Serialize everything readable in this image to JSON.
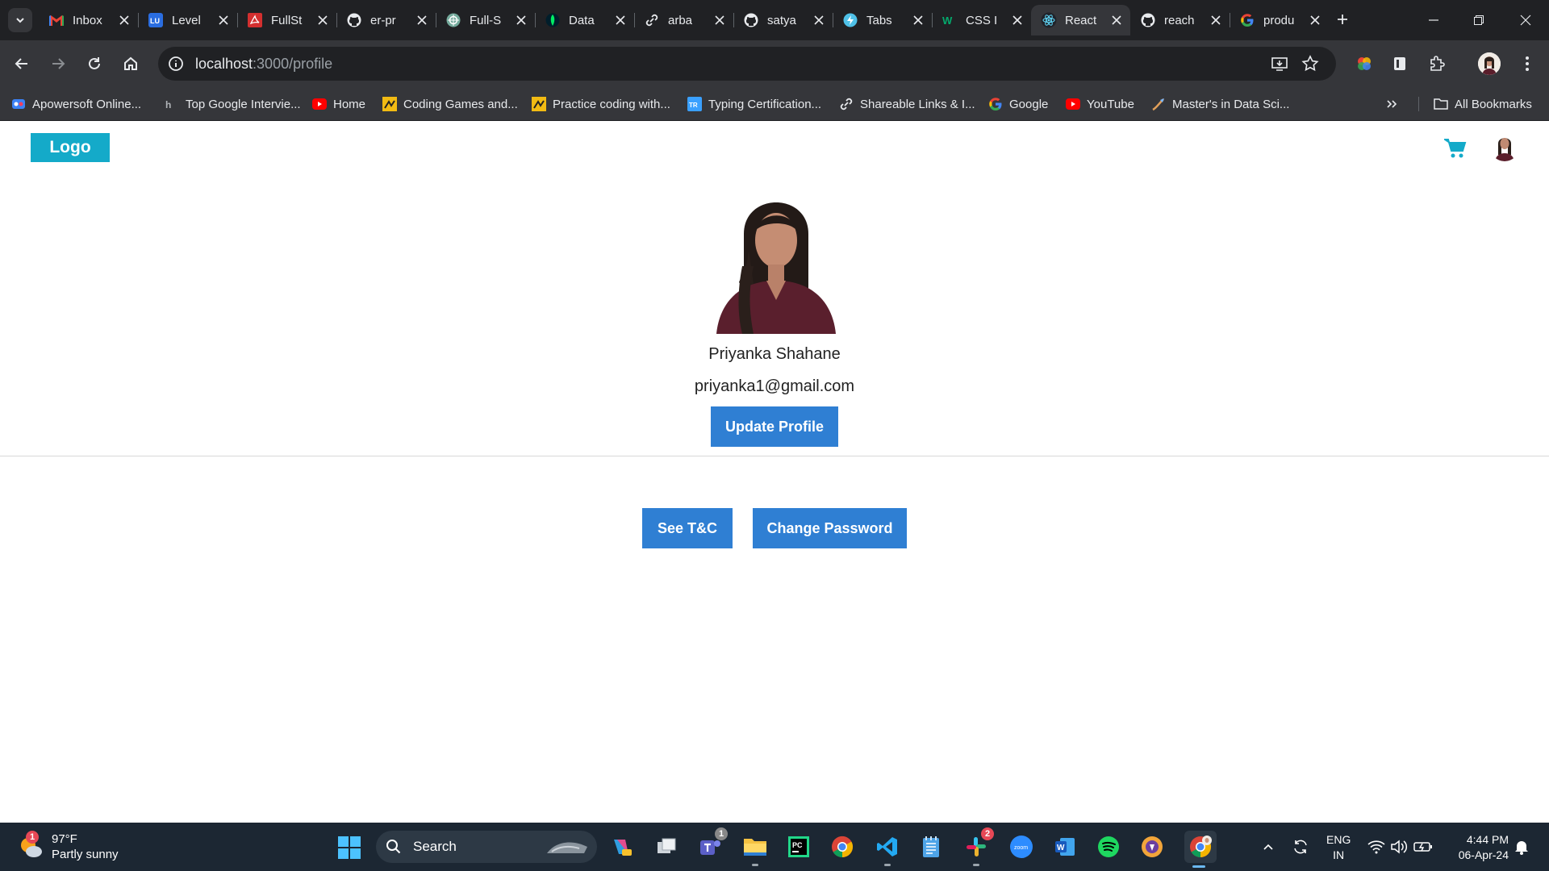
{
  "browser": {
    "tabs": [
      {
        "title": "Inbox",
        "icon": "gmail-icon",
        "active": false
      },
      {
        "title": "Level",
        "icon": "lu-icon",
        "active": false
      },
      {
        "title": "FullSt",
        "icon": "pdf-icon",
        "active": false
      },
      {
        "title": "er-pr",
        "icon": "github-icon",
        "active": false
      },
      {
        "title": "Full-S",
        "icon": "chatgpt-icon",
        "active": false
      },
      {
        "title": "Data",
        "icon": "mongodb-icon",
        "active": false
      },
      {
        "title": "arba",
        "icon": "link-icon",
        "active": false
      },
      {
        "title": "satya",
        "icon": "github-icon",
        "active": false
      },
      {
        "title": "Tabs",
        "icon": "bolt-icon",
        "active": false
      },
      {
        "title": "CSS I",
        "icon": "w3-icon",
        "active": false
      },
      {
        "title": "React",
        "icon": "react-icon",
        "active": true
      },
      {
        "title": "reach",
        "icon": "github-icon",
        "active": false
      },
      {
        "title": "produ",
        "icon": "google-icon",
        "active": false
      }
    ],
    "url_host": "localhost",
    "url_path": ":3000/profile",
    "bookmarks": [
      {
        "label": "Apowersoft Online...",
        "icon": "apowersoft-icon"
      },
      {
        "label": "Top Google Intervie...",
        "icon": "page-icon"
      },
      {
        "label": "Home",
        "icon": "youtube-icon"
      },
      {
        "label": "Coding Games and...",
        "icon": "codingame-icon"
      },
      {
        "label": "Practice coding with...",
        "icon": "codingame-icon"
      },
      {
        "label": "Typing Certification...",
        "icon": "typing-icon"
      },
      {
        "label": "Shareable Links & I...",
        "icon": "link-icon"
      },
      {
        "label": "Google",
        "icon": "google-icon"
      },
      {
        "label": "YouTube",
        "icon": "youtube-icon"
      },
      {
        "label": "Master's in Data Sci...",
        "icon": "grad-icon"
      }
    ],
    "all_bookmarks": "All Bookmarks"
  },
  "page": {
    "logo": "Logo",
    "profile_name": "Priyanka Shahane",
    "profile_email": "priyanka1@gmail.com",
    "update_button": "Update Profile",
    "tc_button": "See T&C",
    "password_button": "Change Password",
    "accent_color": "#14aac9",
    "button_color": "#2f7fd3"
  },
  "taskbar": {
    "weather_temp": "97°F",
    "weather_desc": "Partly sunny",
    "weather_badge": "1",
    "search_label": "Search",
    "teams_badge": "1",
    "slack_badge": "2",
    "lang_top": "ENG",
    "lang_bottom": "IN",
    "time": "4:44 PM",
    "date": "06-Apr-24"
  }
}
